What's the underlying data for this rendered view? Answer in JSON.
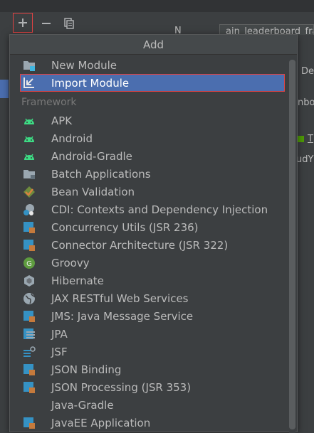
{
  "popup": {
    "title": "Add",
    "top_items": [
      {
        "label": "New Module",
        "icon": "folder-module-icon"
      },
      {
        "label": "Import Module",
        "icon": "import-module-icon",
        "selected": true
      }
    ],
    "section_label": "Framework",
    "framework_items": [
      {
        "label": "APK",
        "icon": "android-icon"
      },
      {
        "label": "Android",
        "icon": "android-icon"
      },
      {
        "label": "Android-Gradle",
        "icon": "android-icon"
      },
      {
        "label": "Batch Applications",
        "icon": "folder-icon"
      },
      {
        "label": "Bean Validation",
        "icon": "bean-validation-icon"
      },
      {
        "label": "CDI: Contexts and Dependency Injection",
        "icon": "cdi-icon"
      },
      {
        "label": "Concurrency Utils (JSR 236)",
        "icon": "javaee-module-icon"
      },
      {
        "label": "Connector Architecture (JSR 322)",
        "icon": "javaee-module-icon"
      },
      {
        "label": "Groovy",
        "icon": "groovy-icon"
      },
      {
        "label": "Hibernate",
        "icon": "hibernate-icon"
      },
      {
        "label": "JAX RESTful Web Services",
        "icon": "globe-icon"
      },
      {
        "label": "JMS: Java Message Service",
        "icon": "javaee-module-icon"
      },
      {
        "label": "JPA",
        "icon": "jpa-icon"
      },
      {
        "label": "JSF",
        "icon": "jsf-icon"
      },
      {
        "label": "JSON Binding",
        "icon": "javaee-module-icon"
      },
      {
        "label": "JSON Processing (JSR 353)",
        "icon": "javaee-module-icon"
      },
      {
        "label": "Java-Gradle",
        "icon": "none"
      },
      {
        "label": "JavaEE Application",
        "icon": "javaee-module-icon"
      }
    ]
  },
  "background": {
    "name_label_fragment": "N",
    "name_value_fragment": "ain_leaderboard_fragment",
    "right_fragments": [
      "De",
      "nbo",
      "T",
      "udY"
    ]
  },
  "colors": {
    "selection": "#4b6eaf",
    "highlight_box": "#e04343",
    "android_green": "#3ddc84"
  }
}
